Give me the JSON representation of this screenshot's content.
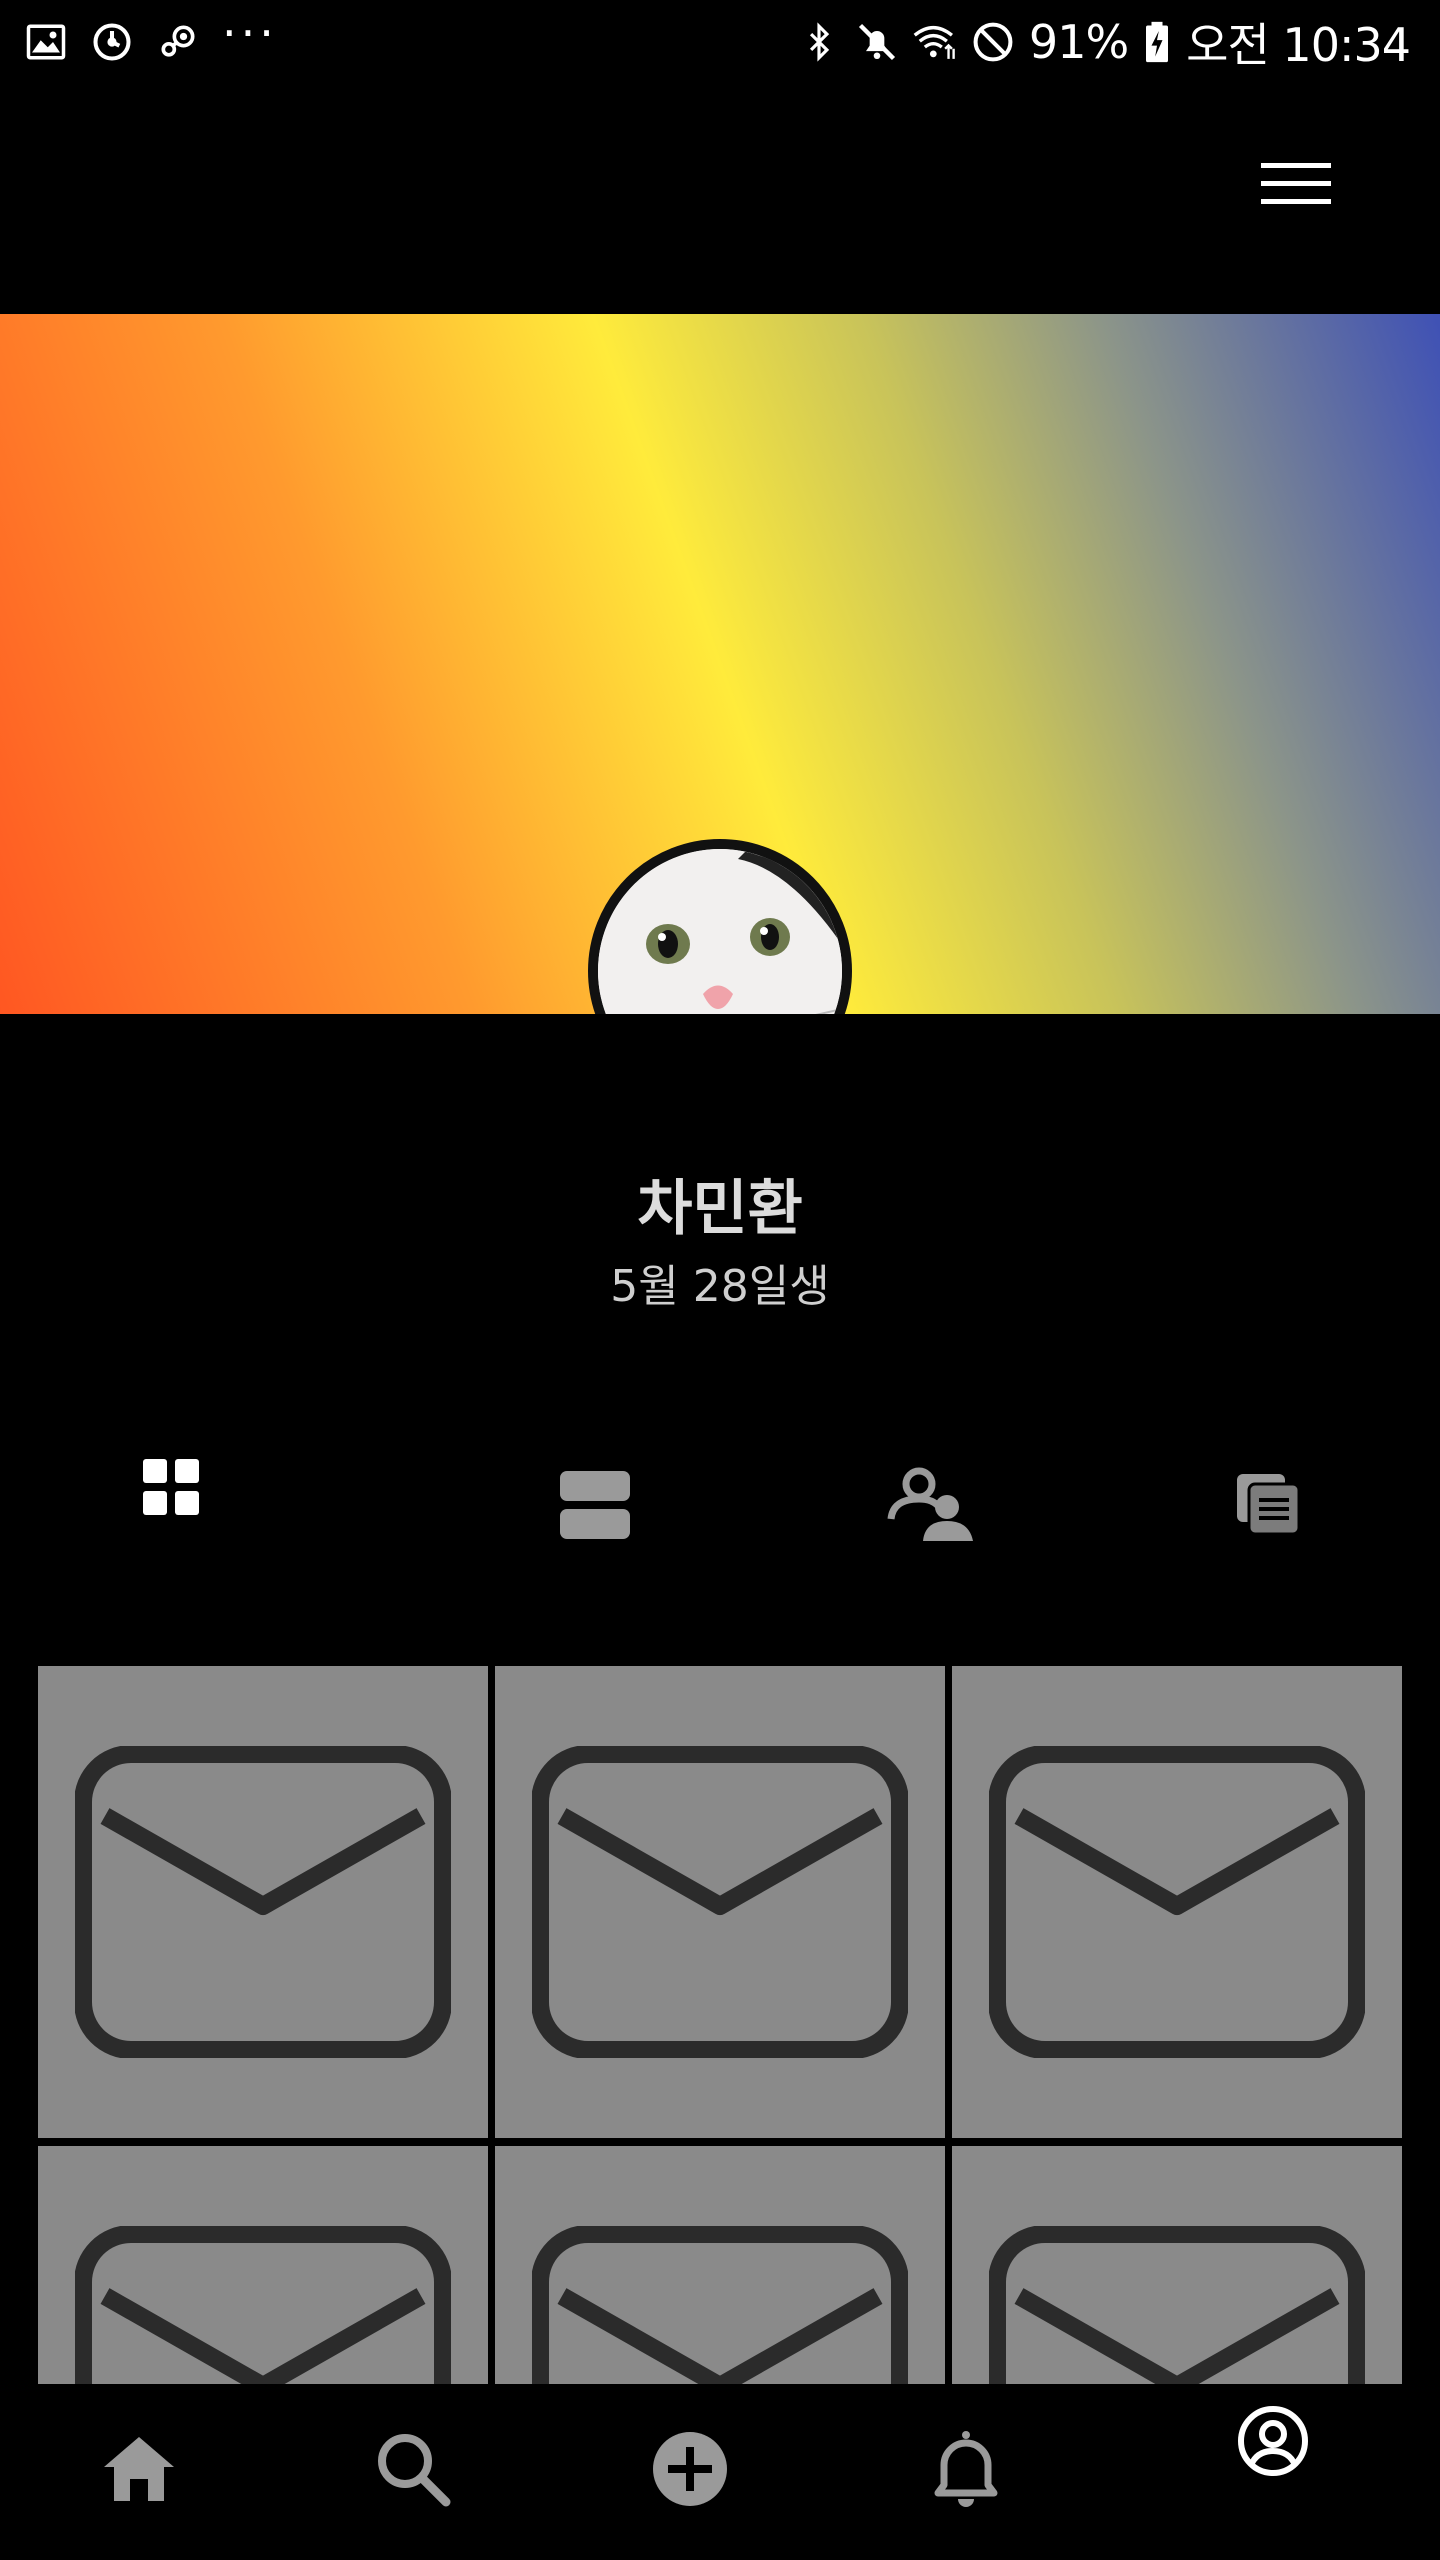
{
  "status_bar": {
    "battery_percent": "91%",
    "time": "오전 10:34",
    "left_icons": [
      "gallery-icon",
      "sync-icon",
      "steam-icon"
    ],
    "overflow": "···",
    "right_icons": [
      "bluetooth-icon",
      "mute-icon",
      "wifi-icon",
      "do-not-disturb-icon",
      "battery-icon"
    ]
  },
  "top_bar": {
    "menu_icon": "hamburger-menu-icon"
  },
  "profile": {
    "name": "차민환",
    "birthday": "5월 28일생",
    "cover_colors": [
      "#ff5722",
      "#ffeb3b",
      "#3f51b5"
    ]
  },
  "tabs": [
    {
      "icon": "grid-view-icon",
      "selected": true
    },
    {
      "icon": "list-view-icon",
      "selected": false
    },
    {
      "icon": "friends-icon",
      "selected": false
    },
    {
      "icon": "documents-icon",
      "selected": false
    }
  ],
  "posts": [
    {
      "icon": "mail-icon"
    },
    {
      "icon": "mail-icon"
    },
    {
      "icon": "mail-icon"
    },
    {
      "icon": "mail-icon"
    },
    {
      "icon": "mail-icon"
    },
    {
      "icon": "mail-icon"
    }
  ],
  "bottom_nav": [
    {
      "icon": "home-icon",
      "selected": false
    },
    {
      "icon": "search-icon",
      "selected": false
    },
    {
      "icon": "add-icon",
      "selected": false
    },
    {
      "icon": "notifications-icon",
      "selected": false
    },
    {
      "icon": "profile-icon",
      "selected": true
    }
  ],
  "colors": {
    "background": "#000000",
    "tile": "#8a8a8a",
    "icon_inactive": "#9a9a9a",
    "icon_active": "#ffffff"
  }
}
